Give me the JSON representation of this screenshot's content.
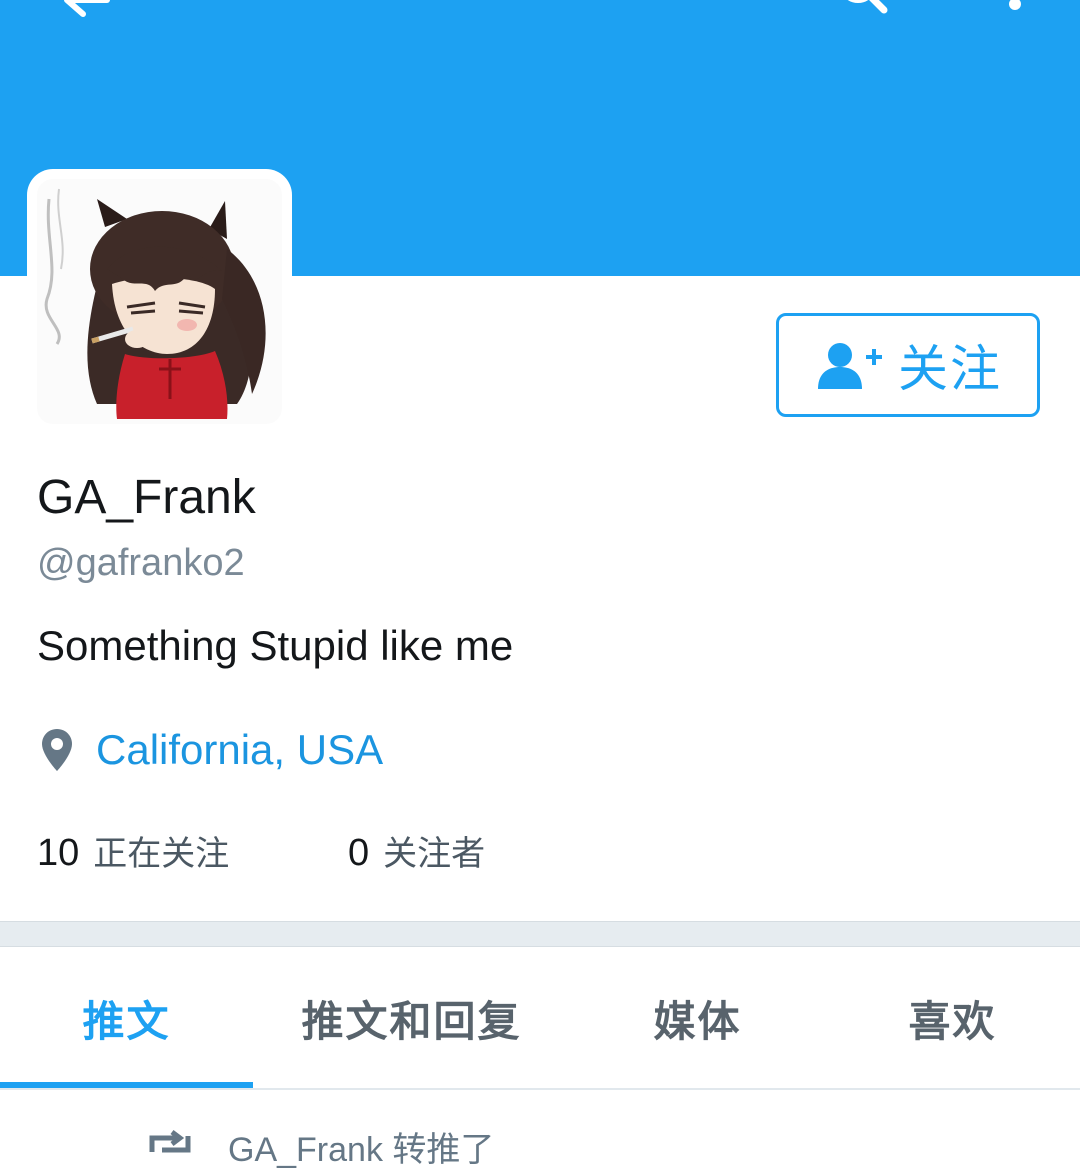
{
  "header": {
    "back_icon": "back-arrow-icon",
    "search_icon": "search-icon",
    "more_icon": "more-vertical-icon",
    "color": "#1da1f2"
  },
  "profile": {
    "display_name": "GA_Frank",
    "handle": "@gafranko2",
    "bio": "Something Stupid like me",
    "location": "California, USA",
    "follow_label": "关注"
  },
  "stats": {
    "following_count": "10",
    "following_label": "正在关注",
    "followers_count": "0",
    "followers_label": "关注者"
  },
  "tabs": [
    {
      "label": "推文",
      "active": true
    },
    {
      "label": "推文和回复",
      "active": false
    },
    {
      "label": "媒体",
      "active": false
    },
    {
      "label": "喜欢",
      "active": false
    }
  ],
  "timeline": {
    "retweet_text": "GA_Frank 转推了"
  },
  "colors": {
    "accent": "#1da1f2",
    "link": "#1b95e0",
    "muted": "#7b8a97"
  }
}
